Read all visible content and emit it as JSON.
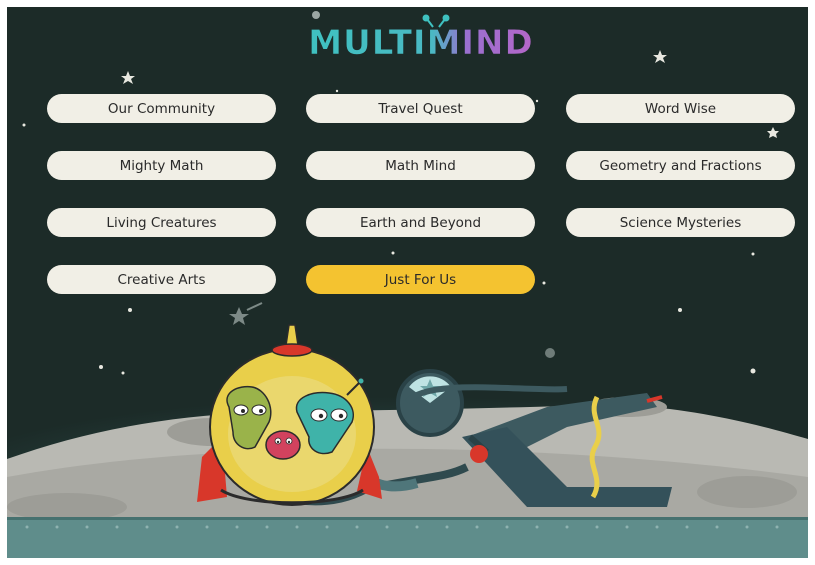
{
  "app": {
    "logo_text": "MULTIMIND"
  },
  "menu": {
    "items": [
      {
        "label": "Our Community",
        "active": false
      },
      {
        "label": "Travel Quest",
        "active": false
      },
      {
        "label": "Word Wise",
        "active": false
      },
      {
        "label": "Mighty Math",
        "active": false
      },
      {
        "label": "Math Mind",
        "active": false
      },
      {
        "label": "Geometry and Fractions",
        "active": false
      },
      {
        "label": "Living Creatures",
        "active": false
      },
      {
        "label": "Earth and Beyond",
        "active": false
      },
      {
        "label": "Science Mysteries",
        "active": false
      },
      {
        "label": "Creative Arts",
        "active": false
      },
      {
        "label": "Just For Us",
        "active": true
      }
    ]
  },
  "colors": {
    "background": "#1c2b28",
    "button": "#f1efe6",
    "button_active": "#f4c330",
    "logo_teal": "#3fc1c0",
    "logo_purple": "#b466c8",
    "rocket_yellow": "#e9cf4a",
    "fin_red": "#d8372a",
    "moon_gray": "#b9b9b3",
    "ground_teal": "#5f8d8b"
  },
  "illustration": {
    "icons": [
      "rocket-icon",
      "alien-green-icon",
      "alien-teal-icon",
      "alien-red-icon",
      "lander-icon",
      "star-icon",
      "moon-surface"
    ]
  }
}
